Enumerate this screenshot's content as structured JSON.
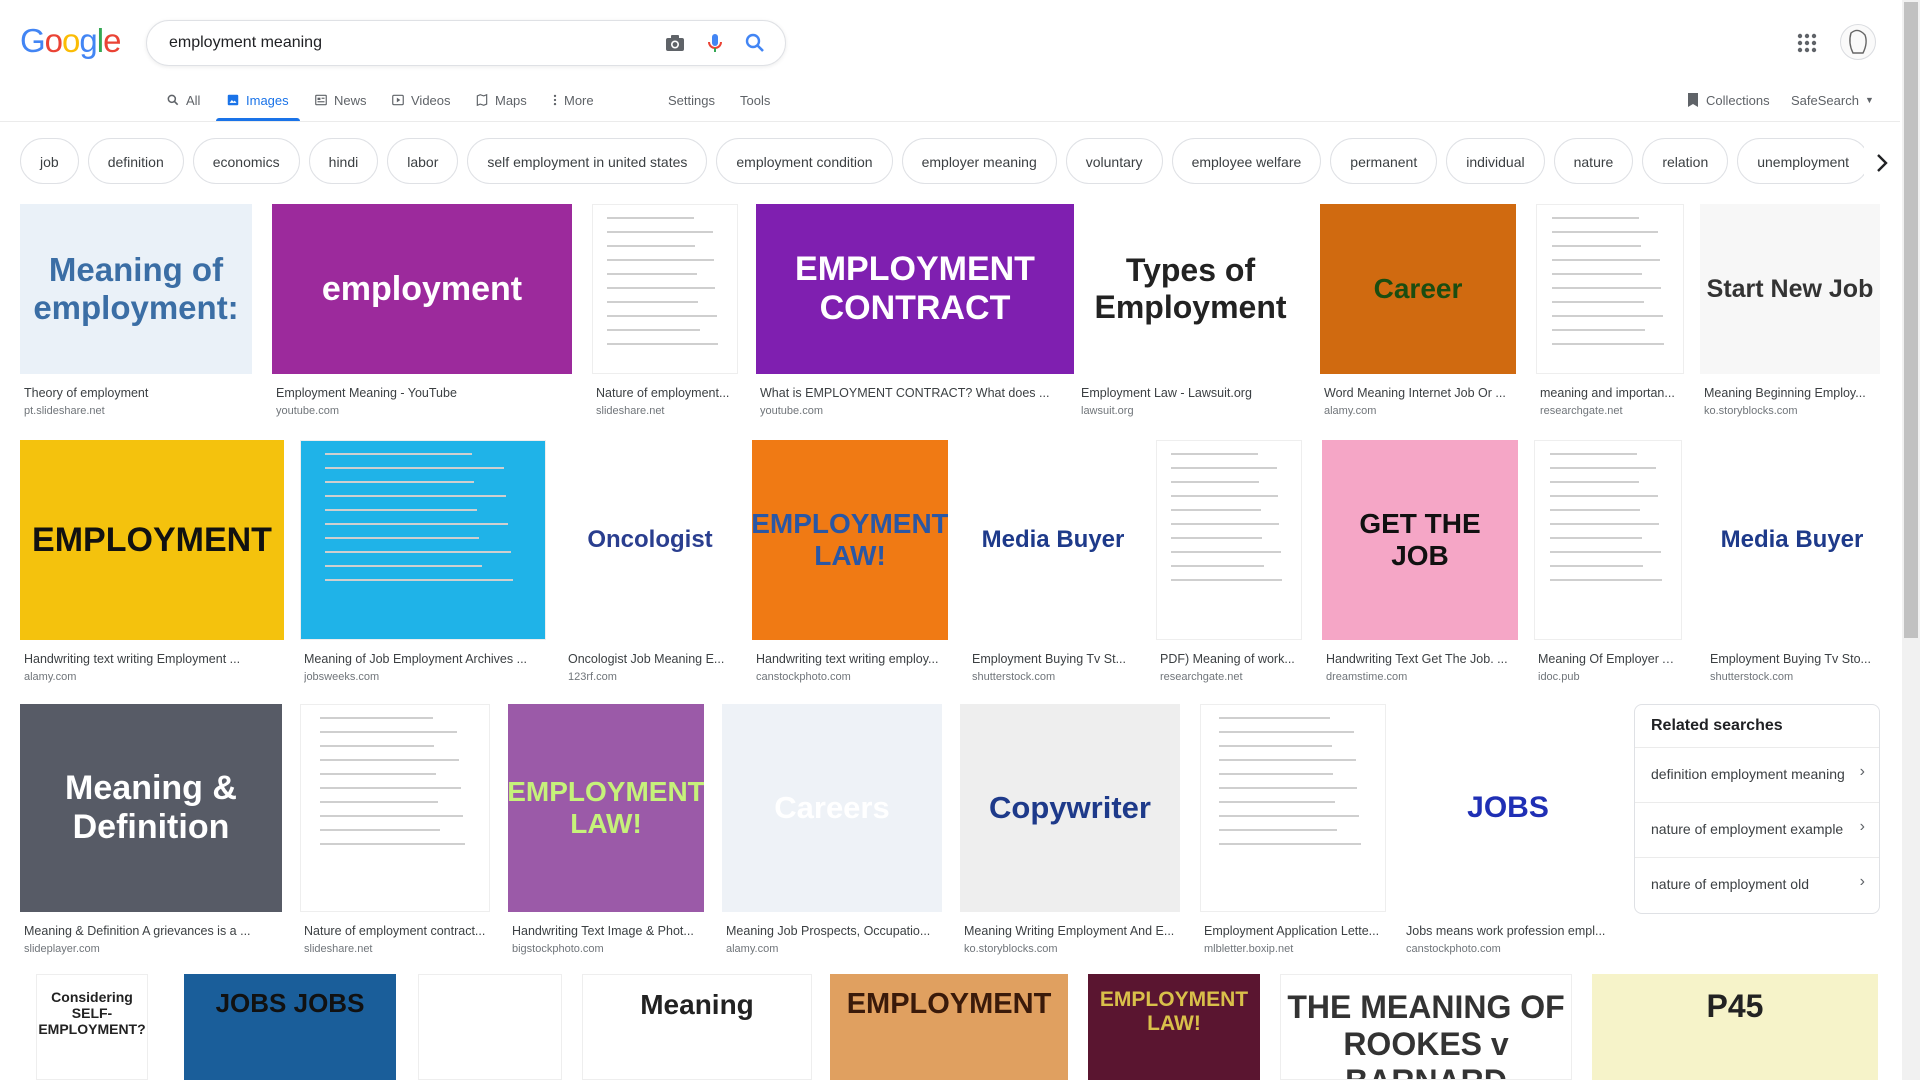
{
  "logo": "Google",
  "search": {
    "value": "employment meaning"
  },
  "tabs": [
    {
      "label": "All"
    },
    {
      "label": "Images"
    },
    {
      "label": "News"
    },
    {
      "label": "Videos"
    },
    {
      "label": "Maps"
    },
    {
      "label": "More"
    }
  ],
  "tools": {
    "settings": "Settings",
    "tools": "Tools"
  },
  "right": {
    "collections": "Collections",
    "safesearch": "SafeSearch"
  },
  "chips": [
    "job",
    "definition",
    "economics",
    "hindi",
    "labor",
    "self employment in united states",
    "employment condition",
    "employer meaning",
    "voluntary",
    "employee welfare",
    "permanent",
    "individual",
    "nature",
    "relation",
    "unemployment"
  ],
  "results": [
    {
      "title": "Theory of employment",
      "source": "pt.slideshare.net",
      "thumb_text": "Meaning of employment:",
      "bg": "#eaf1f8",
      "fg": "#3b6ea5"
    },
    {
      "title": "Employment Meaning - YouTube",
      "source": "youtube.com",
      "thumb_text": "employment",
      "bg": "#9c2a9c",
      "fg": "#ffffff"
    },
    {
      "title": "Nature of employment...",
      "source": "slideshare.net",
      "thumb_text": "",
      "bg": "#ffffff",
      "fg": "#999999"
    },
    {
      "title": "What is EMPLOYMENT CONTRACT? What does ...",
      "source": "youtube.com",
      "thumb_text": "EMPLOYMENT CONTRACT",
      "bg": "#7f1fb0",
      "fg": "#ffffff"
    },
    {
      "title": "Employment Law - Lawsuit.org",
      "source": "lawsuit.org",
      "thumb_text": "Types of Employment",
      "bg": "#ffffff",
      "fg": "#222222"
    },
    {
      "title": "Word Meaning Internet Job Or ...",
      "source": "alamy.com",
      "thumb_text": "Career",
      "bg": "#d06a10",
      "fg": "#1b4d10"
    },
    {
      "title": "meaning and importan...",
      "source": "researchgate.net",
      "thumb_text": "",
      "bg": "#ffffff",
      "fg": "#999999"
    },
    {
      "title": "Meaning Beginning Employ...",
      "source": "ko.storyblocks.com",
      "thumb_text": "Start New Job",
      "bg": "#f7f7f7",
      "fg": "#333333"
    },
    {
      "title": "Handwriting text writing Employment ...",
      "source": "alamy.com",
      "thumb_text": "EMPLOYMENT",
      "bg": "#f4c20d",
      "fg": "#111111"
    },
    {
      "title": "Meaning of Job Employment Archives ...",
      "source": "jobsweeks.com",
      "thumb_text": "",
      "bg": "#1fb3e8",
      "fg": "#ffffff"
    },
    {
      "title": "Oncologist Job Meaning E...",
      "source": "123rf.com",
      "thumb_text": "Oncologist",
      "bg": "#ffffff",
      "fg": "#2a3e8f"
    },
    {
      "title": "Handwriting text writing employ...",
      "source": "canstockphoto.com",
      "thumb_text": "EMPLOYMENT LAW!",
      "bg": "#f07a14",
      "fg": "#2a57a5"
    },
    {
      "title": "Employment Buying Tv St...",
      "source": "shutterstock.com",
      "thumb_text": "Media Buyer",
      "bg": "#ffffff",
      "fg": "#1e3a8a"
    },
    {
      "title": "PDF) Meaning of work...",
      "source": "researchgate.net",
      "thumb_text": "",
      "bg": "#ffffff",
      "fg": "#999999"
    },
    {
      "title": "Handwriting Text Get The Job. ...",
      "source": "dreamstime.com",
      "thumb_text": "GET THE JOB",
      "bg": "#f5a6c6",
      "fg": "#111111"
    },
    {
      "title": "Meaning Of Employer A...",
      "source": "idoc.pub",
      "thumb_text": "",
      "bg": "#ffffff",
      "fg": "#999999"
    },
    {
      "title": "Employment Buying Tv Sto...",
      "source": "shutterstock.com",
      "thumb_text": "Media Buyer",
      "bg": "#ffffff",
      "fg": "#1e3a8a"
    },
    {
      "title": "Meaning & Definition A grievances is a ...",
      "source": "slideplayer.com",
      "thumb_text": "Meaning & Definition",
      "bg": "#575b66",
      "fg": "#ffffff"
    },
    {
      "title": "Nature of employment contract...",
      "source": "slideshare.net",
      "thumb_text": "",
      "bg": "#ffffff",
      "fg": "#999999"
    },
    {
      "title": "Handwriting Text Image & Phot...",
      "source": "bigstockphoto.com",
      "thumb_text": "EMPLOYMENT LAW!",
      "bg": "#9b5aa8",
      "fg": "#c6f27a"
    },
    {
      "title": "Meaning Job Prospects, Occupatio...",
      "source": "alamy.com",
      "thumb_text": "Careers",
      "bg": "#eef2f7",
      "fg": "#ffffff"
    },
    {
      "title": "Meaning Writing Employment And E...",
      "source": "ko.storyblocks.com",
      "thumb_text": "Copywriter",
      "bg": "#eeeeee",
      "fg": "#1e3a8a"
    },
    {
      "title": "Employment Application Lette...",
      "source": "mlbletter.boxip.net",
      "thumb_text": "",
      "bg": "#ffffff",
      "fg": "#999999"
    },
    {
      "title": "Jobs means work profession empl...",
      "source": "canstockphoto.com",
      "thumb_text": "JOBS",
      "bg": "#ffffff",
      "fg": "#1f2fb5"
    }
  ],
  "bottom_row": [
    {
      "thumb_text": "Considering SELF-EMPLOYMENT?",
      "bg": "#ffffff",
      "fg": "#222222"
    },
    {
      "thumb_text": "JOBS JOBS",
      "bg": "#1a5e9a",
      "fg": "#111111"
    },
    {
      "thumb_text": "",
      "bg": "#ffffff",
      "fg": "#999999"
    },
    {
      "thumb_text": "Meaning",
      "bg": "#ffffff",
      "fg": "#222222"
    },
    {
      "thumb_text": "EMPLOYMENT",
      "bg": "#e0a060",
      "fg": "#3a1a0a"
    },
    {
      "thumb_text": "EMPLOYMENT LAW!",
      "bg": "#5a1530",
      "fg": "#d9c04a"
    },
    {
      "thumb_text": "THE MEANING OF ROOKES v BARNARD",
      "bg": "#ffffff",
      "fg": "#333333"
    },
    {
      "thumb_text": "P45",
      "bg": "#f6f3c9",
      "fg": "#222222"
    }
  ],
  "related": {
    "title": "Related searches",
    "items": [
      "definition employment meaning",
      "nature of employment example",
      "nature of employment old"
    ]
  },
  "colors": {
    "accent": "#1a73e8",
    "google_blue": "#4285f4",
    "google_red": "#ea4335",
    "google_yellow": "#fbbc05",
    "google_green": "#34a853"
  }
}
